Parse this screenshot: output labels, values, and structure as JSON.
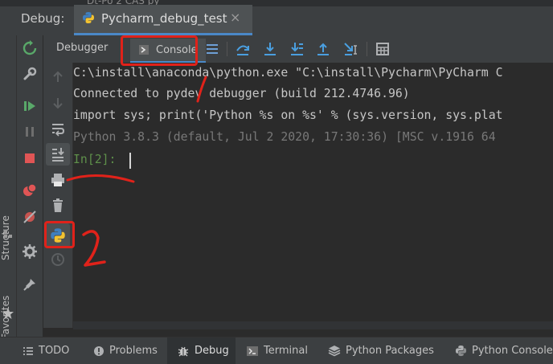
{
  "window": {
    "ghost_tab_text": "Dt-Po 2 CAS py",
    "debug_label": "Debug:",
    "session_tab": "Pycharm_debug_test",
    "close_glyph": "×"
  },
  "tabs": {
    "debugger": "Debugger",
    "console": "Console"
  },
  "side_labels": {
    "structure": "Structure",
    "favorites": "Favorites"
  },
  "console": {
    "lines": [
      "C:\\install\\anaconda\\python.exe \"C:\\install\\Pycharm\\PyCharm C",
      "Connected to pydev debugger (build 212.4746.96)",
      "import sys; print('Python %s on %s' % (sys.version, sys.plat",
      "Python 3.8.3 (default, Jul  2 2020, 17:30:36) [MSC v.1916 64"
    ],
    "prompt": "In[2]:"
  },
  "bottom_bar": {
    "items": [
      "TODO",
      "Problems",
      "Debug",
      "Terminal",
      "Python Packages",
      "Python Console"
    ]
  },
  "annotations": {
    "mark_1": "1",
    "mark_2": "2"
  },
  "colors": {
    "accent_blue": "#4a88c7",
    "annotation_red": "#e0221a",
    "prompt_green": "#5e8f4a"
  },
  "icons": {
    "header": [
      "python-icon",
      "close-icon"
    ],
    "debug_toolbar": [
      "rerun-icon",
      "settings-wrench-icon",
      "resume-icon",
      "pause-icon",
      "stop-icon",
      "view-breakpoints-icon",
      "mute-breakpoints-icon",
      "gear-icon",
      "pin-icon"
    ],
    "console_toolbar": [
      "arrow-up-icon",
      "arrow-down-icon",
      "soft-wrap-icon",
      "scroll-to-end-icon",
      "print-icon",
      "trash-icon",
      "python-console-icon",
      "history-icon"
    ],
    "tab_row": [
      "threads-frames-icon",
      "step-over-icon",
      "step-into-icon",
      "step-into-my-code-icon",
      "step-out-icon",
      "run-to-cursor-icon",
      "evaluate-expression-icon"
    ]
  }
}
